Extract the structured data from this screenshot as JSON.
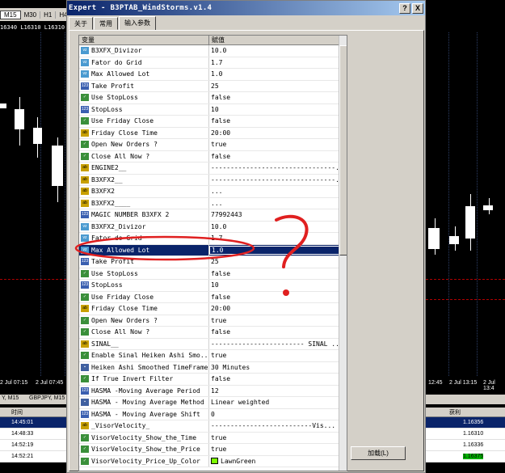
{
  "chart": {
    "timeframes": [
      "M15",
      "M30",
      "H1",
      "H4"
    ],
    "active_timeframe": "M15",
    "top_prices_left": "16340 L16310 L16310",
    "time_labels": [
      "2 Jul 07:15",
      "2 Jul 07:45",
      "12:45",
      "2 Jul 13:15",
      "2 Jul 13:4"
    ],
    "chart_tabs_left": "Y, M15",
    "chart_tabs_mid": "GBPJPY, M15",
    "table_header_left": "时间",
    "table_header_right": "获利",
    "table_rows": [
      {
        "time": "14:45:01",
        "price": "1.16356"
      },
      {
        "time": "14:48:33",
        "price": "1.16310"
      },
      {
        "time": "14:52:19",
        "price": "1.16336"
      },
      {
        "time": "14:52:21",
        "price": "1.16375"
      }
    ]
  },
  "dialog": {
    "title": "Expert - B3PTAB_WindStorms.v1.4",
    "help_button": "?",
    "close_button": "X",
    "tabs": [
      "关于",
      "常用",
      "输入参数"
    ],
    "active_tab": "输入参数",
    "columns": [
      "变量",
      "赋值"
    ],
    "load_button": "加载(L)",
    "rows": [
      {
        "icon": "dbl",
        "icon_label": "vz",
        "name": "B3XFX_Divizor",
        "value": "10.0"
      },
      {
        "icon": "dbl",
        "icon_label": "vz",
        "name": "Fator do Grid",
        "value": "1.7"
      },
      {
        "icon": "dbl",
        "icon_label": "vz",
        "name": "Max Allowed Lot",
        "value": "1.0"
      },
      {
        "icon": "num",
        "icon_label": "123",
        "name": "Take Profit",
        "value": "25"
      },
      {
        "icon": "bool",
        "icon_label": "✓",
        "name": "Use StopLoss",
        "value": "false"
      },
      {
        "icon": "num",
        "icon_label": "123",
        "name": "StopLoss",
        "value": "10"
      },
      {
        "icon": "bool",
        "icon_label": "✓",
        "name": "Use Friday Close",
        "value": "false"
      },
      {
        "icon": "str",
        "icon_label": "ab",
        "name": "Friday Close Time",
        "value": "20:00"
      },
      {
        "icon": "bool",
        "icon_label": "✓",
        "name": "Open New Orders ?",
        "value": "true"
      },
      {
        "icon": "bool",
        "icon_label": "✓",
        "name": "Close All Now ?",
        "value": "false"
      },
      {
        "icon": "str",
        "icon_label": "ab",
        "name": "ENGINE2__",
        "value": "--------------------------------..."
      },
      {
        "icon": "str",
        "icon_label": "ab",
        "name": "B3XFX2__",
        "value": "--------------------------------..."
      },
      {
        "icon": "str",
        "icon_label": "ab",
        "name": "B3XFX2",
        "value": "..."
      },
      {
        "icon": "str",
        "icon_label": "ab",
        "name": "B3XFX2____",
        "value": "..."
      },
      {
        "icon": "num",
        "icon_label": "123",
        "name": "MAGIC NUMBER B3XFX 2",
        "value": "77992443"
      },
      {
        "icon": "dbl",
        "icon_label": "vz",
        "name": "B3XFX2_Divizor",
        "value": "10.0"
      },
      {
        "icon": "dbl",
        "icon_label": "vz",
        "name": "Fator do Grid",
        "value": "1.7"
      },
      {
        "icon": "dbl",
        "icon_label": "vz",
        "name": "Max Allowed Lot",
        "value": "1.0",
        "selected": true
      },
      {
        "icon": "num",
        "icon_label": "123",
        "name": "Take Profit",
        "value": "25"
      },
      {
        "icon": "bool",
        "icon_label": "✓",
        "name": "Use StopLoss",
        "value": "false"
      },
      {
        "icon": "num",
        "icon_label": "123",
        "name": "StopLoss",
        "value": "10"
      },
      {
        "icon": "bool",
        "icon_label": "✓",
        "name": "Use Friday Close",
        "value": "false"
      },
      {
        "icon": "str",
        "icon_label": "ab",
        "name": "Friday Close Time",
        "value": "20:00"
      },
      {
        "icon": "bool",
        "icon_label": "✓",
        "name": "Open New Orders ?",
        "value": "true"
      },
      {
        "icon": "bool",
        "icon_label": "✓",
        "name": "Close All Now ?",
        "value": "false"
      },
      {
        "icon": "str",
        "icon_label": "ab",
        "name": "SINAL__",
        "value": "------------------------ SINAL ..."
      },
      {
        "icon": "bool",
        "icon_label": "✓",
        "name": "Enable Sinal  Heiken Ashi Smo...",
        "value": "true"
      },
      {
        "icon": "enum",
        "icon_label": "▪",
        "name": "Heiken Ashi Smoothed TimeFrame",
        "value": "30 Minutes"
      },
      {
        "icon": "bool",
        "icon_label": "✓",
        "name": "If True Invert Filter",
        "value": "false"
      },
      {
        "icon": "num",
        "icon_label": "123",
        "name": "HASMA -Moving Average Period",
        "value": "12"
      },
      {
        "icon": "enum",
        "icon_label": "▪",
        "name": "HASMA - Moving Average Method",
        "value": "Linear weighted"
      },
      {
        "icon": "num",
        "icon_label": "123",
        "name": "HASMA - Moving Average Shift",
        "value": "0"
      },
      {
        "icon": "str",
        "icon_label": "ab",
        "name": "_VisorVelocity_",
        "value": "--------------------------Vis..."
      },
      {
        "icon": "bool",
        "icon_label": "✓",
        "name": "VisorVelocity_Show_the_Time",
        "value": "true"
      },
      {
        "icon": "bool",
        "icon_label": "✓",
        "name": "VisorVelocity_Show_the_Price",
        "value": "true"
      },
      {
        "icon": "color",
        "icon_label": "✓",
        "name": "VisorVelocity_Price_Up_Color",
        "value": "LawnGreen",
        "swatch": "#7cfc00"
      }
    ]
  },
  "annotation": {
    "color": "#e02020",
    "symbol": "?"
  }
}
